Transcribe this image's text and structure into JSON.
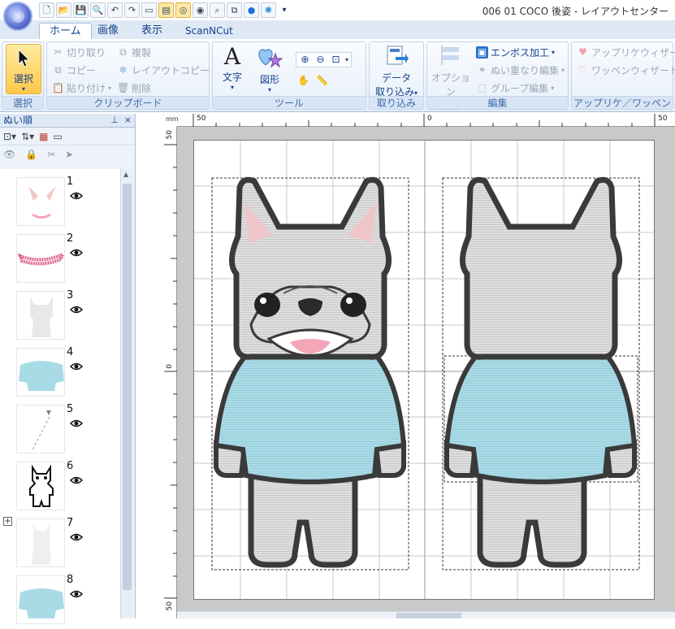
{
  "window": {
    "title": "006 01 COCO 後姿 - レイアウトセンター"
  },
  "quick_access": {
    "icons": [
      "new-file-icon",
      "open-folder-icon",
      "save-icon",
      "zoom-icon",
      "undo-icon",
      "redo-icon",
      "toolbar-icon",
      "stitch-icon",
      "view-icon",
      "hoop-icon",
      "preview-icon",
      "copy-icon",
      "color-icon",
      "settings-icon"
    ],
    "dropdown": "▾"
  },
  "tabs": [
    {
      "label": "ホーム",
      "active": true
    },
    {
      "label": "画像"
    },
    {
      "label": "表示"
    },
    {
      "label": "ScanNCut"
    }
  ],
  "ribbon": {
    "select_group": {
      "button": "選択",
      "label": "選択"
    },
    "clipboard": {
      "label": "クリップボード",
      "cut": "切り取り",
      "copy": "コピー",
      "paste": "貼り付け",
      "duplicate": "複製",
      "layout_copy": "レイアウトコピー",
      "delete": "削除"
    },
    "tools": {
      "label": "ツール",
      "text": "文字",
      "shape": "図形"
    },
    "import": {
      "label": "取り込み",
      "data_import_1": "データ",
      "data_import_2": "取り込み"
    },
    "edit": {
      "label": "編集",
      "option_edit_1": "オプション",
      "option_edit_2": "編集",
      "emboss": "エンボス加工",
      "stitch_overlap": "ぬい重なり編集",
      "group_edit": "グループ編集"
    },
    "applique": {
      "label": "アップリケ／ワッペン",
      "applique_wizard": "アップリケウィザード",
      "patch_wizard": "ワッペンウィザード"
    }
  },
  "panel": {
    "title": "ぬい順",
    "pin": "ㅁ",
    "close": "×",
    "items": [
      {
        "num": "1",
        "color": "#f4c6c6"
      },
      {
        "num": "2",
        "color": "#e0608f"
      },
      {
        "num": "3",
        "color": "#e6e6e6"
      },
      {
        "num": "4",
        "color": "#a9dbe6"
      },
      {
        "num": "5",
        "color": "#808080"
      },
      {
        "num": "6",
        "color": "#111111"
      },
      {
        "num": "7",
        "color": "#eeeeee"
      },
      {
        "num": "8",
        "color": "#a9dbe6"
      }
    ]
  },
  "rulers": {
    "unit": "mm",
    "top": [
      "50",
      "0",
      "50"
    ],
    "left": [
      "50",
      "0",
      "50"
    ]
  },
  "colors": {
    "shirt": "#a8dde8",
    "body": "#dcdcdc",
    "outline": "#3a3a3a",
    "ear_inner": "#f2c3c8",
    "tongue": "#f4a5b8"
  }
}
